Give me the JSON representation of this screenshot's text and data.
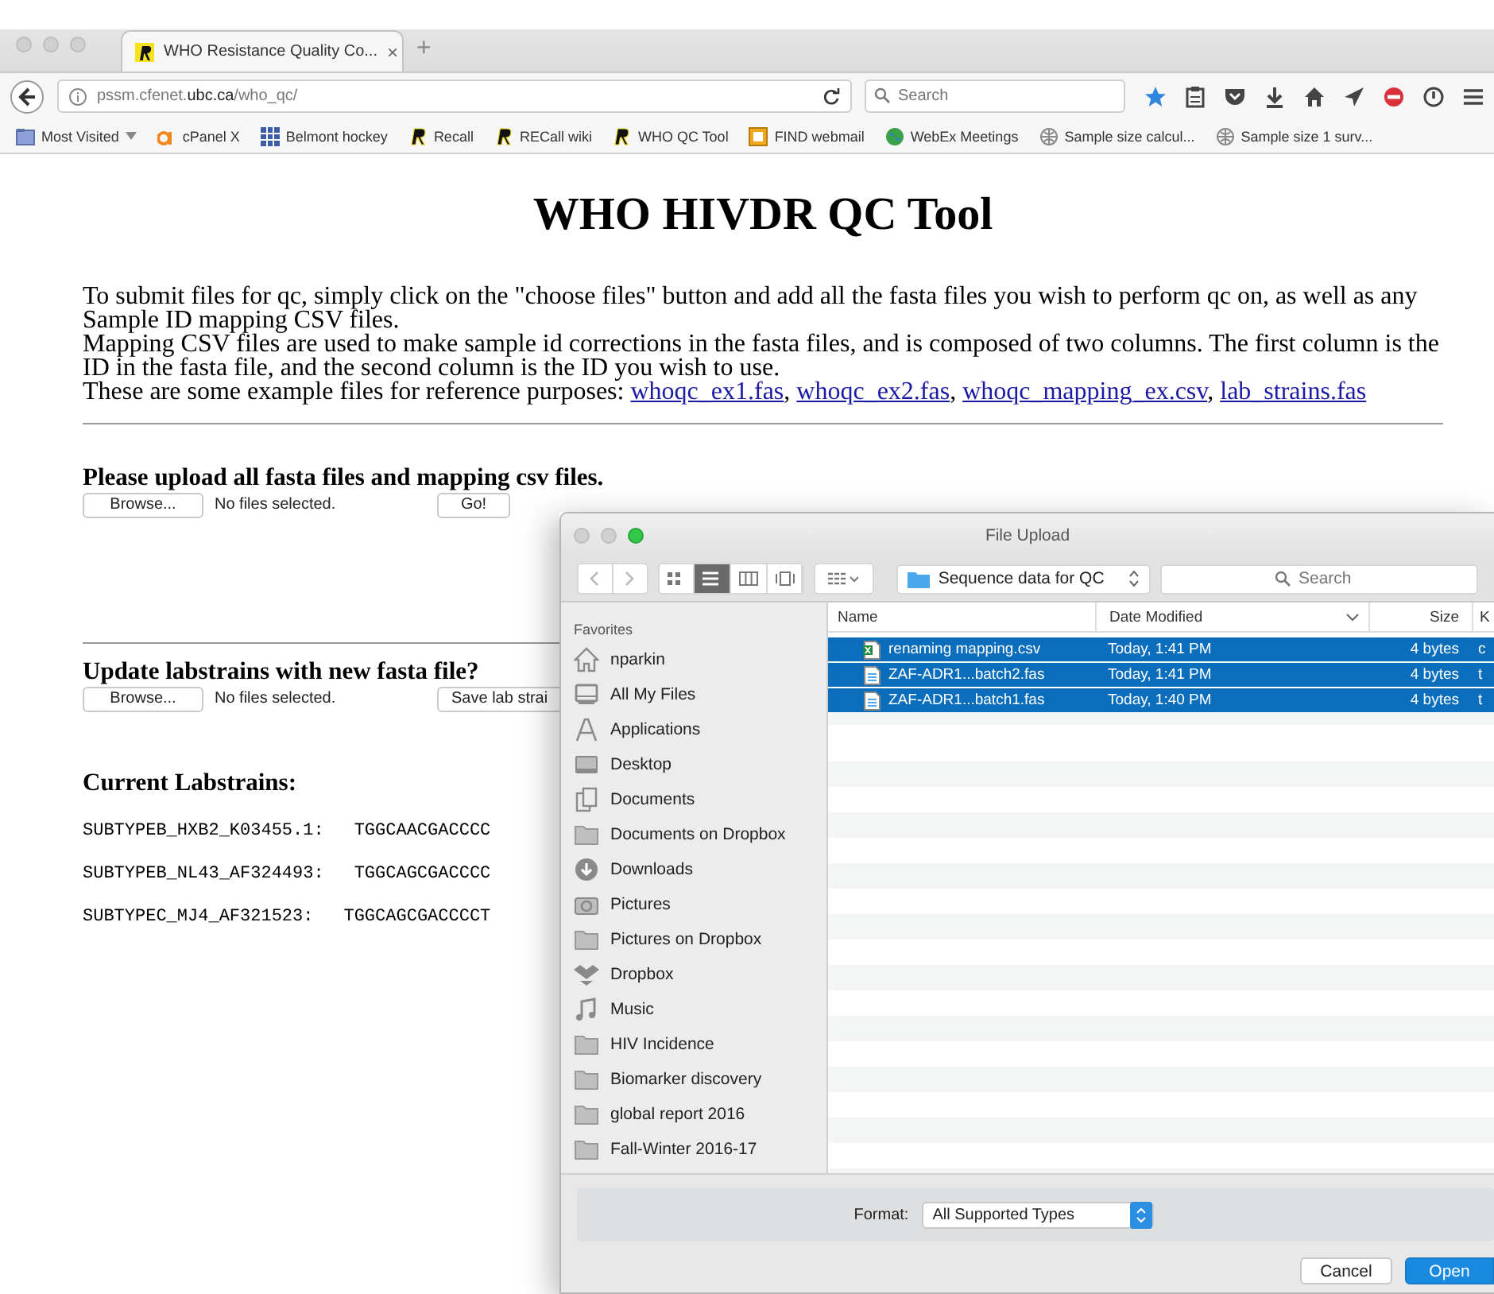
{
  "browser": {
    "tab": {
      "title": "WHO Resistance Quality Co...",
      "close": "×",
      "selected": true
    },
    "new_tab": "+",
    "address": "pssm.cfenet.**ubc.ca**/who_qc/",
    "search": {
      "placeholder": "Search"
    },
    "bookmarks": [
      {
        "label": "Most Visited",
        "kind": "folder-menu"
      },
      {
        "label": "cPanel X",
        "kind": "cp"
      },
      {
        "label": "Belmont hockey",
        "kind": "grid"
      },
      {
        "label": "Recall",
        "kind": "r"
      },
      {
        "label": "RECall wiki",
        "kind": "r"
      },
      {
        "label": "WHO QC Tool",
        "kind": "r"
      },
      {
        "label": "FIND webmail",
        "kind": "mail"
      },
      {
        "label": "WebEx Meetings",
        "kind": "globe"
      },
      {
        "label": "Sample size calcul...",
        "kind": "web"
      },
      {
        "label": "Sample size 1 surv...",
        "kind": "web"
      }
    ]
  },
  "page": {
    "title": "WHO HIVDR QC Tool",
    "intro": [
      "To submit files for qc, simply click on the \"choose files\" button and add all the fasta files you wish to perform qc on, as well as any Sample ID mapping CSV files.",
      "Mapping CSV files are used to make sample id corrections in the fasta files, and is composed of two columns. The first column is the ID in the fasta file, and the second column is the ID you wish to use."
    ],
    "examples": {
      "text": "These are some example files for reference purposes:",
      "separator": ",",
      "links": [
        "whoqc_ex1.fas",
        "whoqc_ex2.fas",
        "whoqc_mapping_ex.csv",
        "lab_strains.fas"
      ]
    },
    "upload": {
      "heading": "Please upload all fasta files and mapping csv files.",
      "browse": "Browse...",
      "status": "No files selected.",
      "submit": "Go!"
    },
    "labstrain_upload": {
      "heading": "Update labstrains with new fasta file?",
      "browse": "Browse...",
      "status": "No files selected.",
      "submit": "Save lab strai"
    },
    "labstrains": {
      "heading": "Current Labstrains:",
      "items": [
        {
          "name": "SUBTYPEB_HXB2_K03455.1:",
          "sequence": "TGGCAACGACCCC"
        },
        {
          "name": "SUBTYPEB_NL43_AF324493:",
          "sequence": "TGGCAGCGACCCC"
        },
        {
          "name": "SUBTYPEC_MJ4_AF321523:",
          "sequence": "TGGCAGCGACCCCT"
        }
      ]
    }
  },
  "dialog": {
    "title": "File Upload",
    "view_buttons": [
      {
        "kind": "icons",
        "selected": false
      },
      {
        "kind": "list",
        "selected": true
      },
      {
        "kind": "columns",
        "selected": false
      },
      {
        "kind": "flow",
        "selected": false
      }
    ],
    "location": "Sequence data for QC",
    "search": {
      "placeholder": "Search"
    },
    "sidebar": {
      "heading": "Favorites",
      "items": [
        {
          "label": "nparkin",
          "kind": "home"
        },
        {
          "label": "All My Files",
          "kind": "files"
        },
        {
          "label": "Applications",
          "kind": "apps"
        },
        {
          "label": "Desktop",
          "kind": "desktop"
        },
        {
          "label": "Documents",
          "kind": "docs"
        },
        {
          "label": "Documents on Dropbox",
          "kind": "folder"
        },
        {
          "label": "Downloads",
          "kind": "download"
        },
        {
          "label": "Pictures",
          "kind": "camera"
        },
        {
          "label": "Pictures on Dropbox",
          "kind": "folder"
        },
        {
          "label": "Dropbox",
          "kind": "dropbox"
        },
        {
          "label": "Music",
          "kind": "music"
        },
        {
          "label": "HIV Incidence",
          "kind": "folder"
        },
        {
          "label": "Biomarker discovery",
          "kind": "folder"
        },
        {
          "label": "global report 2016",
          "kind": "folder"
        },
        {
          "label": "Fall-Winter 2016-17",
          "kind": "folder"
        }
      ]
    },
    "columns": [
      {
        "label": "Name"
      },
      {
        "label": "Date Modified",
        "sorted": true
      },
      {
        "label": "Size"
      },
      {
        "label": "K"
      }
    ],
    "files": [
      {
        "name": "renaming mapping.csv",
        "kind": "sheet",
        "date": "Today, 1:41 PM",
        "size": "4 bytes",
        "column_4": "c",
        "selected": true
      },
      {
        "name": "ZAF-ADR1...batch2.fas",
        "kind": "doc",
        "date": "Today, 1:41 PM",
        "size": "4 bytes",
        "column_4": "t",
        "selected": true
      },
      {
        "name": "ZAF-ADR1...batch1.fas",
        "kind": "doc",
        "date": "Today, 1:40 PM",
        "size": "4 bytes",
        "column_4": "t",
        "selected": true
      }
    ],
    "format": {
      "label": "Format:",
      "value": "All Supported Types"
    },
    "buttons": [
      {
        "label": "Cancel",
        "default": false
      },
      {
        "label": "Open",
        "default": true
      }
    ]
  }
}
